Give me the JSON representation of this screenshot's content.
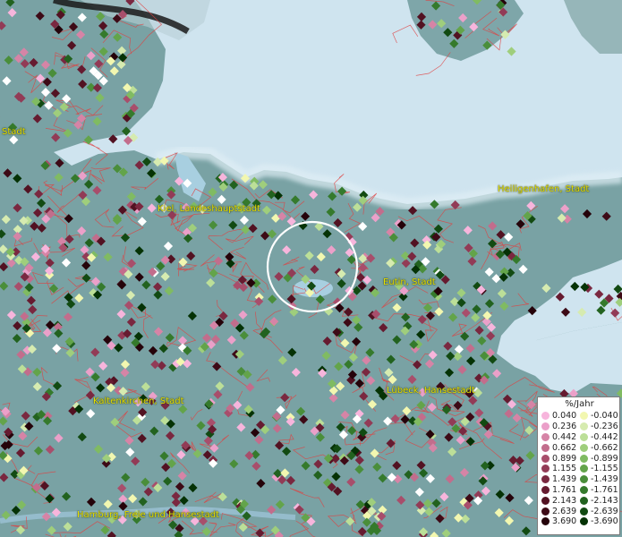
{
  "map": {
    "places": [
      {
        "id": "stadt-left",
        "label": "Stadt"
      },
      {
        "id": "kiel",
        "label": "Kiel, Landeshauptstadt"
      },
      {
        "id": "heiligenhafen",
        "label": "Heiligenhafen, Stadt"
      },
      {
        "id": "eutin",
        "label": "Eutin, Stadt"
      },
      {
        "id": "kaltenkirchen",
        "label": "Kaltenkirchen, Stadt"
      },
      {
        "id": "luebeck",
        "label": "Lübeck, Hansestadt"
      },
      {
        "id": "hamburg",
        "label": "Hamburg, Freie und Hansestadt"
      }
    ],
    "colors": {
      "sea": "#cfe4ef",
      "land": "#79a2a4",
      "borders": "#e04040",
      "highlight_circle": "#ffffff"
    }
  },
  "legend": {
    "title": "%/Jahr",
    "positive": [
      {
        "label": "0.040",
        "color": "#f7b5dc"
      },
      {
        "label": "0.236",
        "color": "#eba0c9"
      },
      {
        "label": "0.442",
        "color": "#d684a6"
      },
      {
        "label": "0.662",
        "color": "#c26d8c"
      },
      {
        "label": "0.899",
        "color": "#a84e6b"
      },
      {
        "label": "1.155",
        "color": "#923b56"
      },
      {
        "label": "1.439",
        "color": "#7a2840"
      },
      {
        "label": "1.761",
        "color": "#661b30"
      },
      {
        "label": "2.143",
        "color": "#521222"
      },
      {
        "label": "2.639",
        "color": "#3d0a16"
      },
      {
        "label": "3.690",
        "color": "#25030a"
      }
    ],
    "negative": [
      {
        "label": "-0.040",
        "color": "#f2f7b0"
      },
      {
        "label": "-0.236",
        "color": "#d6ebb0"
      },
      {
        "label": "-0.442",
        "color": "#bcdf98"
      },
      {
        "label": "-0.662",
        "color": "#9fce7c"
      },
      {
        "label": "-0.899",
        "color": "#80bb62"
      },
      {
        "label": "-1.155",
        "color": "#63a44a"
      },
      {
        "label": "-1.439",
        "color": "#4a8e3a"
      },
      {
        "label": "-1.761",
        "color": "#357a2c"
      },
      {
        "label": "-2.143",
        "color": "#22621f"
      },
      {
        "label": "-2.639",
        "color": "#124a12"
      },
      {
        "label": "-3.690",
        "color": "#053205"
      }
    ]
  }
}
